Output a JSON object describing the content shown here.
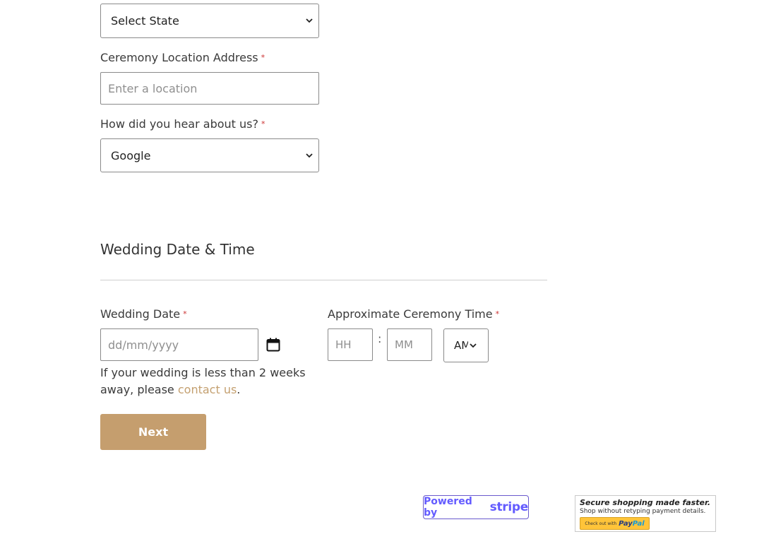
{
  "state_select": {
    "value": "Select State"
  },
  "ceremony_location": {
    "label": "Ceremony Location Address",
    "required_mark": "*",
    "placeholder": "Enter a location"
  },
  "referral": {
    "label": "How did you hear about us?",
    "required_mark": "*",
    "value": "Google"
  },
  "section": {
    "title": "Wedding Date & Time"
  },
  "wedding_date": {
    "label": "Wedding Date",
    "required_mark": "*",
    "placeholder": "dd/mm/yyyy",
    "icon": "calendar-icon"
  },
  "ceremony_time": {
    "label": "Approximate Ceremony Time",
    "required_mark": "*",
    "hour_placeholder": "HH",
    "separator": ":",
    "minute_placeholder": "MM",
    "ampm_value": "AM"
  },
  "help": {
    "text_before": "If your wedding is less than 2 weeks away, please ",
    "link_text": "contact us",
    "text_after": "."
  },
  "next_button": {
    "label": "Next"
  },
  "stripe_badge": {
    "prefix": "Powered by",
    "brand": "stripe"
  },
  "paypal_badge": {
    "headline": "Secure shopping made faster.",
    "subline": "Shop without retyping payment details.",
    "button_prefix": "Check out with",
    "button_brand_a": "Pay",
    "button_brand_b": "Pal"
  },
  "colors": {
    "accent": "#c59e6e",
    "link": "#c4a070",
    "required": "#cc3333",
    "stripe": "#635bff",
    "paypal_yellow": "#ffc439"
  }
}
